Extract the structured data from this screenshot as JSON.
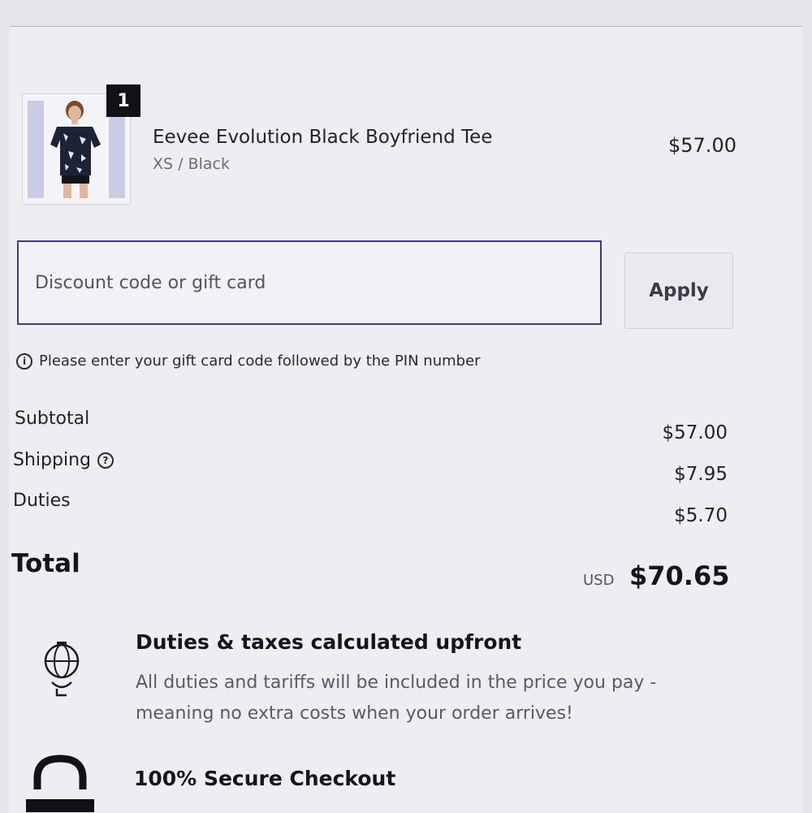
{
  "product": {
    "quantity": "1",
    "name": "Eevee Evolution Black Boyfriend Tee",
    "variant": "XS / Black",
    "price": "$57.00"
  },
  "discount": {
    "placeholder": "Discount code or gift card",
    "value": "",
    "apply_label": "Apply",
    "hint": "Please enter your gift card code followed by the PIN number"
  },
  "summary": {
    "subtotal_label": "Subtotal",
    "subtotal_value": "$57.00",
    "shipping_label": "Shipping",
    "shipping_value": "$7.95",
    "duties_label": "Duties",
    "duties_value": "$5.70",
    "total_label": "Total",
    "total_currency": "USD",
    "total_value": "$70.65"
  },
  "features": [
    {
      "icon": "globe-icon",
      "title": "Duties & taxes calculated upfront",
      "description": "All duties and tariffs will be included in the price you pay - meaning no extra costs when your order arrives!"
    },
    {
      "icon": "lock-icon",
      "title": "100% Secure Checkout",
      "description": ""
    }
  ],
  "colors": {
    "accent_border": "#3d3a7c",
    "badge_bg": "#111116",
    "page_bg": "#ededf2"
  }
}
